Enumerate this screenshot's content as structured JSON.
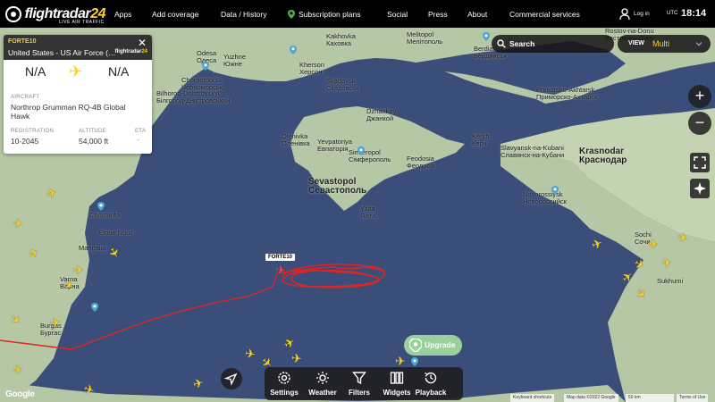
{
  "nav": {
    "logo_main": "flightradar",
    "logo_num": "24",
    "logo_sub": "LIVE AIR TRAFFIC",
    "items": [
      "Apps",
      "Add coverage",
      "Data / History",
      "Subscription plans",
      "Social",
      "Press",
      "About",
      "Commercial services"
    ],
    "login": "Log in",
    "tz": "UTC",
    "time": "18:14"
  },
  "panel": {
    "callsign": "FORTE10",
    "operator": "United States - US Air Force (…",
    "origin": "N/A",
    "destination": "N/A",
    "aircraft_label": "AIRCRAFT",
    "aircraft": "Northrop Grumman RQ-4B Global Hawk",
    "registration_label": "REGISTRATION",
    "registration": "10-2045",
    "altitude_label": "ALTITUDE",
    "altitude": "54,000 ft",
    "eta_label": "ETA",
    "eta": "-"
  },
  "search": {
    "label": "Search"
  },
  "view": {
    "label": "VIEW",
    "value": "Multi"
  },
  "zoom": {
    "in": "+",
    "out": "−"
  },
  "map_tag": "FORTE10",
  "upgrade": "Upgrade",
  "bottombar": [
    "Settings",
    "Weather",
    "Filters",
    "Widgets",
    "Playback"
  ],
  "attribution": {
    "shortcuts": "Keyboard shortcuts",
    "mapdata": "Map data ©2022 Google",
    "scale": "50 km",
    "terms": "Terms of Use"
  },
  "google": "Google",
  "places": [
    {
      "t": "Odesa\nОдеса",
      "c": "big-sm"
    },
    {
      "t": "Kherson\nХерсон"
    },
    {
      "t": "Melitopol\nМелітополь"
    },
    {
      "t": "Berdiansk\nБердянськ"
    },
    {
      "t": "Rostov-na-Donu\nРостов-на-Дону"
    },
    {
      "t": "Kakhovka\nКаховка"
    },
    {
      "t": "Yuzhne\nЮжне"
    },
    {
      "t": "Chornomorsk\nЧорноморськ"
    },
    {
      "t": "Bilhorod-Dnistrovskyi\nБілгород-Дністровський"
    },
    {
      "t": "Skadovsk\nСкадовськ"
    },
    {
      "t": "Olenivka\nОленівка"
    },
    {
      "t": "Dzhankoy\nДжанкой"
    },
    {
      "t": "Yevpatoriya\nЕвпаторія"
    },
    {
      "t": "Simferopol\nСімферополь"
    },
    {
      "t": "Feodosia\nФеодосія"
    },
    {
      "t": "Kerch\nКерч"
    },
    {
      "t": "Sevastopol\nСевастополь",
      "c": "big"
    },
    {
      "t": "Yalta\nЯлта"
    },
    {
      "t": "Primorsko-Akhtarsk\nПриморско-Ахтарск"
    },
    {
      "t": "Slavyansk-na-Kubani\nСлавянск-на-Кубани"
    },
    {
      "t": "Krasnodar\nКраснодар",
      "c": "big"
    },
    {
      "t": "Novorossiysk\nНовороссийск"
    },
    {
      "t": "Constanța"
    },
    {
      "t": "Eforie Nord"
    },
    {
      "t": "Mangalia"
    },
    {
      "t": "Varna\nВарна"
    },
    {
      "t": "Burgas\nБургас"
    },
    {
      "t": "Sukhumi"
    },
    {
      "t": "Sochi\nСочи"
    }
  ]
}
